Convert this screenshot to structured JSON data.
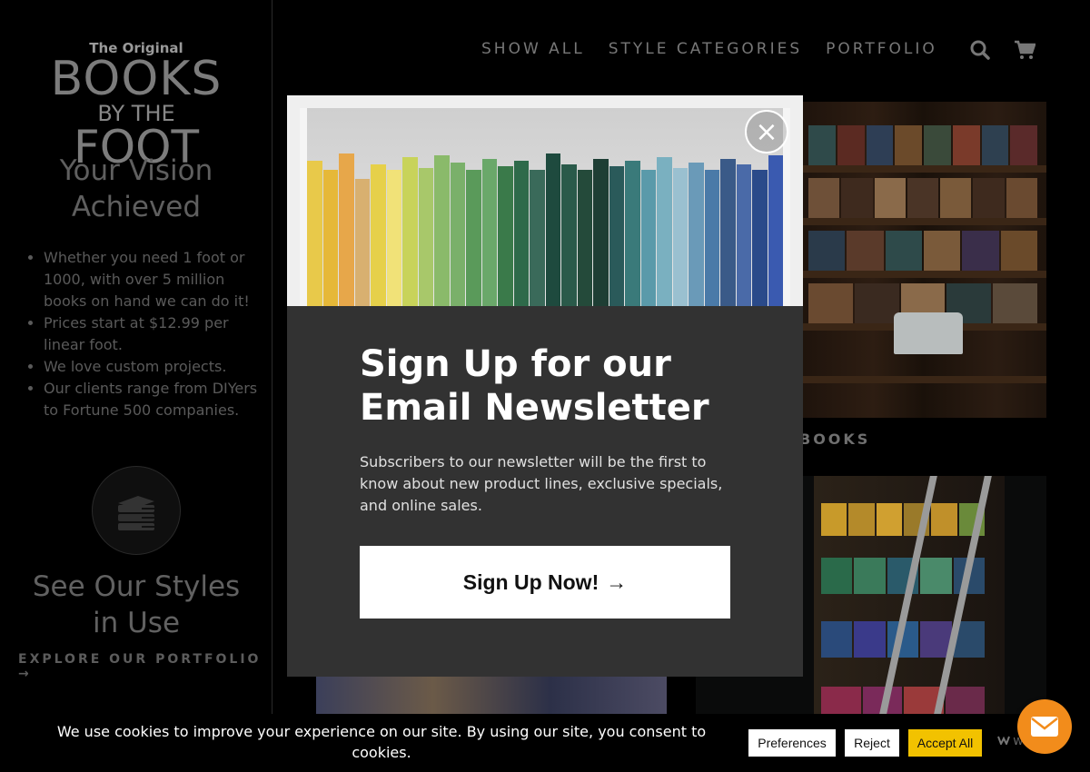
{
  "sidebar": {
    "logo": {
      "line1": "The Original",
      "line2": "BOOKS",
      "line3": "BY THE",
      "line4": "FOOT"
    },
    "headline": "Your Vision Achieved",
    "bullets": [
      "Whether you need 1 foot or 1000, with over 5 million books on hand we can do it!",
      "Prices start at $12.99 per linear foot.",
      "We love custom projects.",
      "Our clients range from DIYers to Fortune 500 companies."
    ],
    "see_styles": "See Our Styles in Use",
    "explore_link": "EXPLORE OUR PORTFOLIO →"
  },
  "nav": {
    "items": [
      "SHOW ALL",
      "STYLE CATEGORIES",
      "PORTFOLIO"
    ],
    "icons": [
      "search-icon",
      "cart-icon"
    ]
  },
  "gallery": {
    "label_partial": "BOOKS"
  },
  "modal": {
    "title": "Sign Up for our Email Newsletter",
    "text": "Subscribers to our newsletter will be the first to know about new product lines, exclusive specials, and online sales.",
    "button_label": "Sign Up Now!",
    "button_arrow": "→",
    "close_symbol": "×"
  },
  "cookie": {
    "text": "We use cookies to improve your experience on our site. By using our site, you consent to cookies.",
    "preferences": "Preferences",
    "reject": "Reject",
    "accept": "Accept All",
    "brand_fragment": "W"
  },
  "colors": {
    "accent_yellow": "#f2c200",
    "chat_orange": "#f28c1b",
    "modal_bg": "#323232"
  }
}
